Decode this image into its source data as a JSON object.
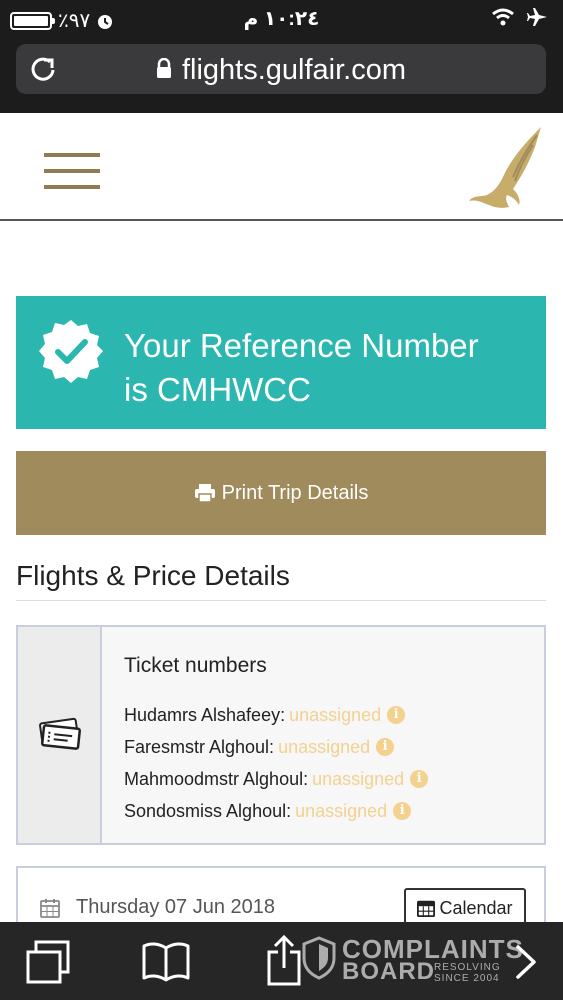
{
  "status_bar": {
    "battery_text": "٪٩٧",
    "time": "١٠:٢٤ م"
  },
  "browser": {
    "url": "flights.gulfair.com"
  },
  "reference": {
    "line1": "Your Reference Number",
    "line2": "is CMHWCC"
  },
  "print_button": {
    "label": "Print Trip Details"
  },
  "section": {
    "title": "Flights & Price Details"
  },
  "tickets": {
    "title": "Ticket numbers",
    "passengers": [
      {
        "name": "Hudamrs Alshafeey:",
        "status": "unassigned"
      },
      {
        "name": "Faresmstr Alghoul:",
        "status": "unassigned"
      },
      {
        "name": "Mahmoodmstr Alghoul:",
        "status": "unassigned"
      },
      {
        "name": "Sondosmiss Alghoul:",
        "status": "unassigned"
      }
    ]
  },
  "flight_date": {
    "date": "Thursday 07 Jun 2018",
    "calendar_label": "Calendar"
  },
  "watermark": {
    "line1": "COMPLAINTS",
    "line2": "BOARD",
    "sub1": "RESOLVING",
    "sub2": "SINCE 2004"
  },
  "colors": {
    "teal": "#2bb7b0",
    "gold": "#a08b5c",
    "unassigned": "#f3d18f"
  },
  "icons": [
    "battery-icon",
    "alarm-icon",
    "wifi-icon",
    "airplane-mode-icon",
    "reload-icon",
    "lock-icon",
    "hamburger-menu-icon",
    "gulfair-falcon-logo",
    "checkmark-badge-icon",
    "printer-icon",
    "ticket-icon",
    "info-icon",
    "calendar-icon",
    "tabs-icon",
    "bookmarks-icon",
    "share-icon",
    "forward-chevron-icon"
  ]
}
